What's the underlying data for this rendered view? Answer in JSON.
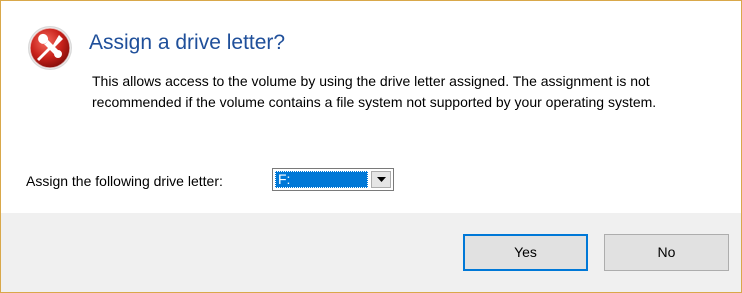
{
  "dialog": {
    "title": "Assign a drive letter?",
    "description": "This allows access to the volume by using the drive letter assigned. The assignment is not recommended if the volume contains a file system not supported by your operating system.",
    "icon": "tools-icon",
    "accent_color": "#1f4f9a"
  },
  "drive_letter": {
    "label": "Assign the following drive letter:",
    "selected_value": "F:",
    "arrow_icon": "chevron-down-icon"
  },
  "buttons": {
    "yes_label": "Yes",
    "no_label": "No"
  }
}
